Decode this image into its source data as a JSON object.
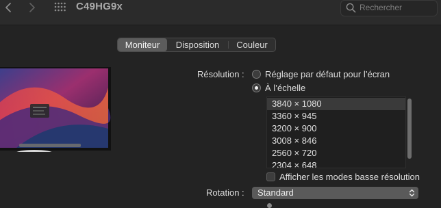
{
  "toolbar": {
    "title": "C49HG9x",
    "search_placeholder": "Rechercher",
    "icons": [
      "chevron-left-icon",
      "chevron-right-icon",
      "grid-icon",
      "search-icon"
    ]
  },
  "tabs": [
    {
      "label": "Moniteur",
      "active": true
    },
    {
      "label": "Disposition",
      "active": false
    },
    {
      "label": "Couleur",
      "active": false
    }
  ],
  "resolution": {
    "label": "Résolution :",
    "option_default": "Réglage par défaut pour l’écran",
    "option_scaled": "À l’échelle",
    "selected_option": "scaled",
    "list": [
      "3840 × 1080",
      "3360 × 945",
      "3200 × 900",
      "3008 × 846",
      "2560 × 720",
      "2304 × 648"
    ],
    "selected_index": 0,
    "low_res_checkbox": "Afficher les modes basse résolution",
    "low_res_checked": false
  },
  "rotation": {
    "label": "Rotation :",
    "value": "Standard"
  },
  "colors": {
    "background": "#232323",
    "toolbar": "#2b2b2b",
    "active_tab": "#5c5c5c",
    "list_selected": "#3a3a3a"
  }
}
